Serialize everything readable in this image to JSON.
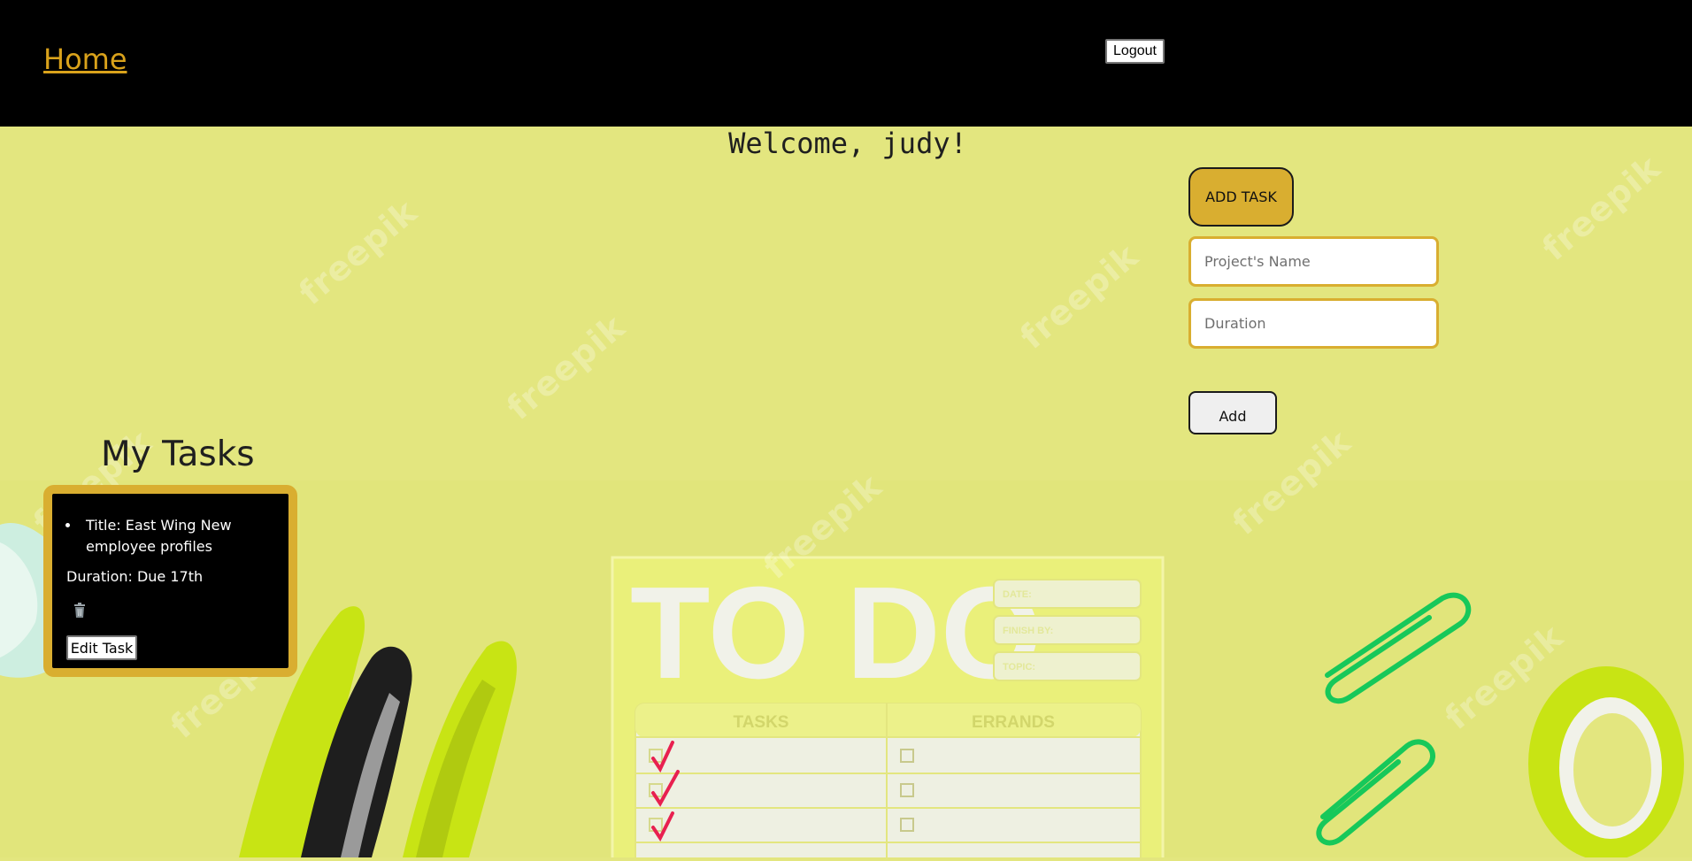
{
  "header": {
    "home_link": "Home",
    "logout_label": "Logout"
  },
  "welcome": {
    "text": "Welcome, judy!"
  },
  "add_task_form": {
    "toggle_label": "ADD TASK",
    "project_name_placeholder": "Project's Name",
    "duration_placeholder": "Duration",
    "submit_label": "Add"
  },
  "my_tasks": {
    "heading": "My Tasks",
    "tasks": [
      {
        "title_line": "Title: East Wing New employee profiles",
        "duration_line": "Duration: Due 17th",
        "delete_icon": "trash-icon",
        "edit_label": "Edit Task"
      }
    ]
  },
  "background": {
    "todo_pad_title": "TO DO",
    "date_label": "DATE:",
    "finish_by_label": "FINISH BY:",
    "topic_label": "TOPIC:",
    "tasks_column": "TASKS",
    "errands_column": "ERRANDS",
    "watermark": "freepik"
  },
  "colors": {
    "background": "#e3e67f",
    "header": "#000000",
    "accent_gold": "#d9ae30",
    "link": "#d9a21b"
  }
}
